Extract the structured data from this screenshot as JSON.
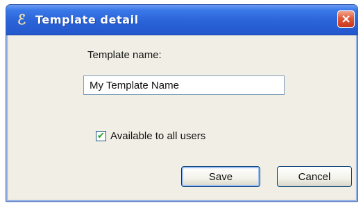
{
  "window": {
    "title": "Template detail",
    "title_icon": "app-icon",
    "close_label": "×"
  },
  "form": {
    "name_label": "Template name:",
    "name_value": "My Template Name",
    "available_label": "Available to all users",
    "available_checked": true,
    "check_mark": "✔"
  },
  "buttons": {
    "save_label": "Save",
    "cancel_label": "Cancel"
  },
  "colors": {
    "titlebar": "#2a63d8",
    "close": "#e0583a",
    "client_bg": "#f1efe5"
  }
}
